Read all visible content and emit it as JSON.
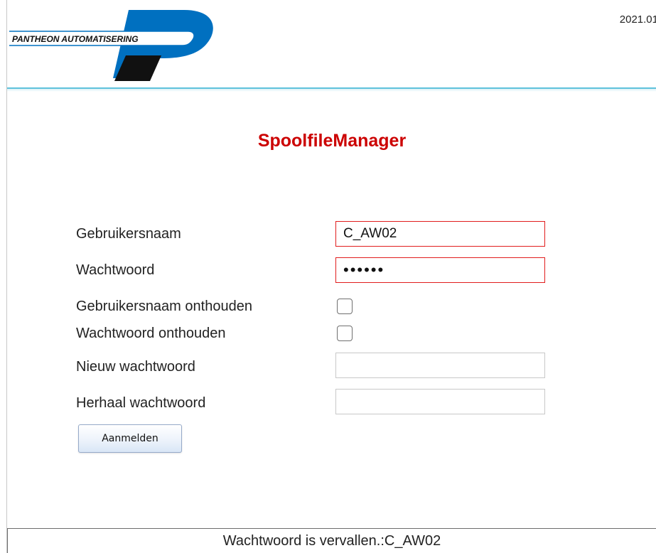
{
  "header": {
    "logo_text": "PANTHEON AUTOMATISERING",
    "version": "2021.01"
  },
  "title": "SpoolfileManager",
  "form": {
    "username_label": "Gebruikersnaam",
    "username_value": "C_AW02",
    "password_label": "Wachtwoord",
    "password_value": "••••••",
    "remember_username_label": "Gebruikersnaam onthouden",
    "remember_username_checked": false,
    "remember_password_label": "Wachtwoord onthouden",
    "remember_password_checked": false,
    "new_password_label": "Nieuw wachtwoord",
    "new_password_value": "",
    "repeat_password_label": "Herhaal wachtwoord",
    "repeat_password_value": "",
    "submit_label": "Aanmelden"
  },
  "status": {
    "message": "Wachtwoord is vervallen.:C_AW02"
  },
  "colors": {
    "accent_line": "#5fc2dc",
    "title_red": "#cc0000",
    "error_border": "#e11d1d",
    "logo_blue": "#0070c0",
    "logo_black": "#111111"
  }
}
